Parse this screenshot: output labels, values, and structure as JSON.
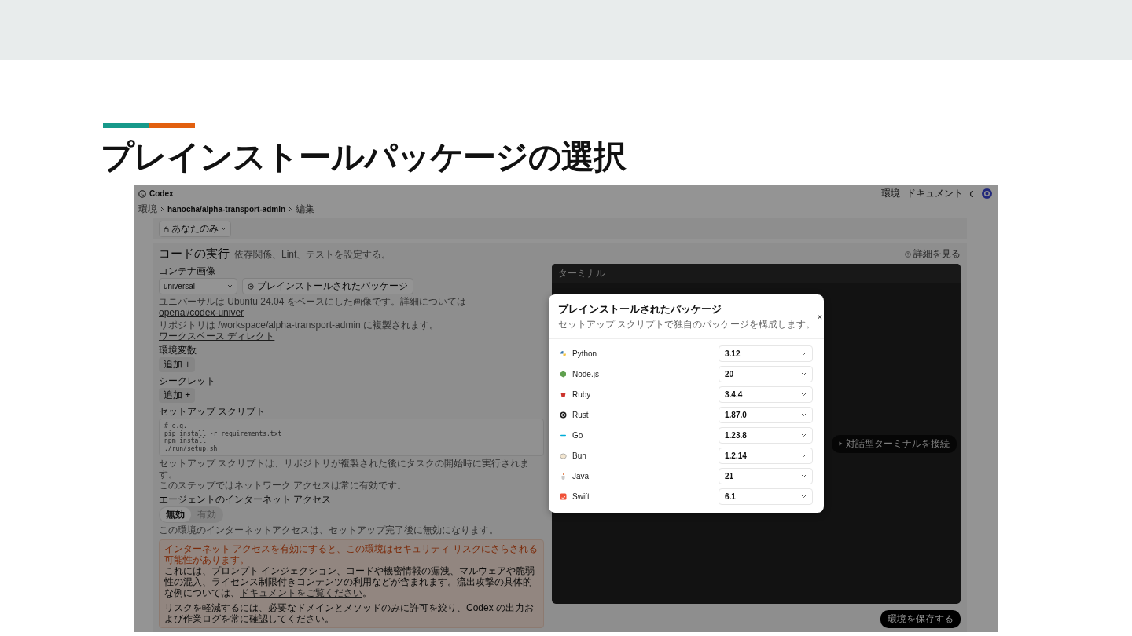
{
  "slide": {
    "title": "プレインストールパッケージの選択"
  },
  "app": {
    "header": {
      "brand": "Codex",
      "links": [
        "環境",
        "ドキュメント"
      ]
    },
    "breadcrumb": [
      "環境",
      "hanocha/alpha-transport-admin",
      "編集"
    ],
    "visibility": "あなたのみ",
    "section": {
      "title": "コードの実行",
      "subtitle": "依存関係、Lint、テストを設定する。",
      "help_link": "詳細を見る"
    },
    "container_image": {
      "label": "コンテナ画像",
      "value": "universal",
      "packages_button": "プレインストールされたパッケージ",
      "description": [
        {
          "text": "ユニバーサルは Ubuntu 24.04 をベースにした画像です。詳細については ",
          "link": "openai/codex-univer"
        },
        {
          "text": "リポジトリは /workspace/alpha-transport-admin に複製されます。",
          "link": "ワークスペース ディレクト"
        }
      ]
    },
    "env_vars": {
      "label": "環境変数",
      "button": "追加 +"
    },
    "secrets": {
      "label": "シークレット",
      "button": "追加 +"
    },
    "setup_script": {
      "label": "セットアップ スクリプト",
      "placeholder": "# e.g.\npip install -r requirements.txt\nnpm install\n./run/setup.sh",
      "note": [
        "セットアップ スクリプトは、リポジトリが複製された後にタスクの開始時に実行されます。",
        "このステップではネットワーク アクセスは常に有効です。"
      ]
    },
    "internet_access": {
      "label": "エージェントのインターネット アクセス",
      "options": [
        {
          "label": "無効",
          "selected": true
        },
        {
          "label": "有効",
          "selected": false
        }
      ],
      "note": "この環境のインターネットアクセスは、セットアップ完了後に無効になります。"
    },
    "warning": {
      "headline": "インターネット アクセスを有効にすると、この環境はセキュリティ リスクにさらされる可能性があります。",
      "body": "これには、プロンプト インジェクション、コードや機密情報の漏洩、マルウェアや脆弱性の混入、ライセンス制限付きコンテンツの利用などが含まれます。流出攻撃の具体的な例については、",
      "body_link": "ドキュメントをご覧ください",
      "body_end": "。",
      "advice": "リスクを軽減するには、必要なドメインとメソッドのみに許可を絞り、Codex の出力および作業ログを常に確認してください。"
    },
    "terminal": {
      "title": "ターミナル",
      "connect_button": "対話型ターミナルを接続"
    },
    "save_button": "環境を保存する"
  },
  "modal": {
    "title": "プレインストールされたパッケージ",
    "subtitle": "セットアップ スクリプトで独自のパッケージを構成します。",
    "close": "×",
    "packages": [
      {
        "name": "Python",
        "version": "3.12"
      },
      {
        "name": "Node.js",
        "version": "20"
      },
      {
        "name": "Ruby",
        "version": "3.4.4"
      },
      {
        "name": "Rust",
        "version": "1.87.0"
      },
      {
        "name": "Go",
        "version": "1.23.8"
      },
      {
        "name": "Bun",
        "version": "1.2.14"
      },
      {
        "name": "Java",
        "version": "21"
      },
      {
        "name": "Swift",
        "version": "6.1"
      }
    ]
  }
}
